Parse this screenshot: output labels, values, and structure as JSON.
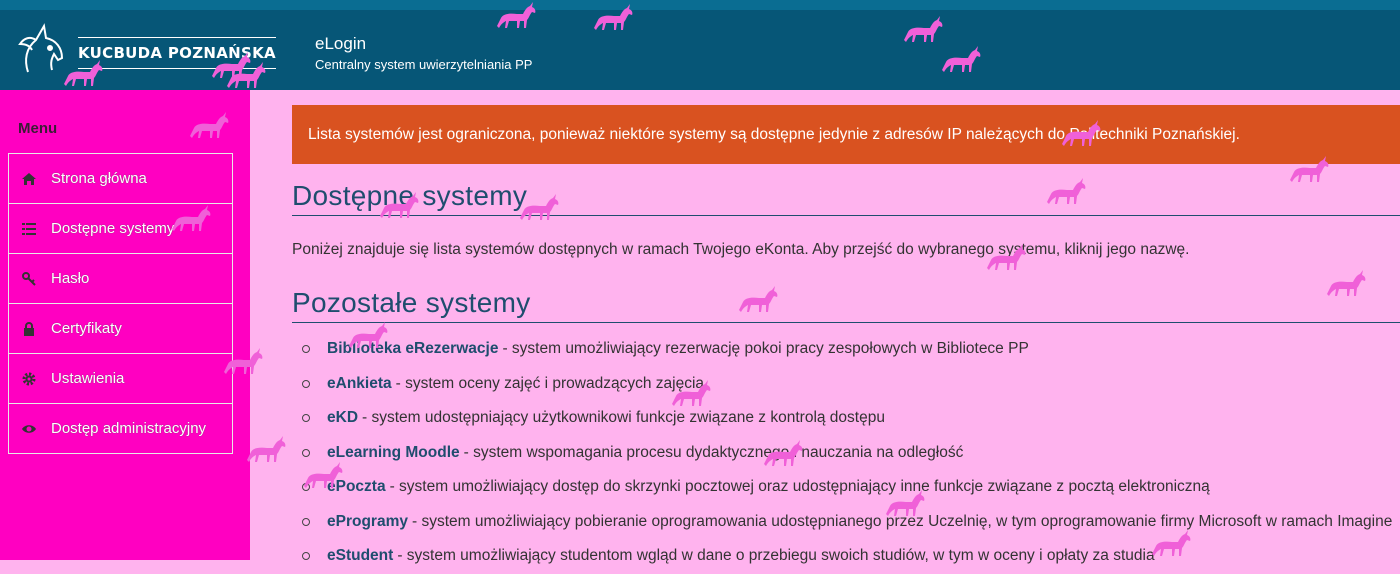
{
  "header": {
    "logo_text": "KUCBUDA POZNAŃSKA",
    "app_title": "eLogin",
    "app_subtitle": "Centralny system uwierzytelniania PP"
  },
  "sidebar": {
    "heading": "Menu",
    "items": [
      {
        "label": "Strona główna",
        "icon": "home-icon"
      },
      {
        "label": "Dostępne systemy",
        "icon": "list-icon"
      },
      {
        "label": "Hasło",
        "icon": "key-icon"
      },
      {
        "label": "Certyfikaty",
        "icon": "lock-icon"
      },
      {
        "label": "Ustawienia",
        "icon": "gear-icon"
      },
      {
        "label": "Dostęp administracyjny",
        "icon": "eye-icon"
      }
    ]
  },
  "main": {
    "alert": "Lista systemów jest ograniczona, ponieważ niektóre systemy są dostępne jedynie z adresów IP należących do Politechniki Poznańskiej.",
    "available_heading": "Dostępne systemy",
    "intro": "Poniżej znajduje się lista systemów dostępnych w ramach Twojego eKonta. Aby przejść do wybranego systemu, kliknij jego nazwę.",
    "other_heading": "Pozostałe systemy",
    "systems": [
      {
        "name": "Biblioteka eRezerwacje",
        "desc": "- system umożliwiający rezerwację pokoi pracy zespołowych w Bibliotece PP"
      },
      {
        "name": "eAnkieta",
        "desc": "- system oceny zajęć i prowadzących zajęcia"
      },
      {
        "name": "eKD",
        "desc": "- system udostępniający użytkownikowi funkcje związane z kontrolą dostępu"
      },
      {
        "name": "eLearning Moodle",
        "desc": "- system wspomagania procesu dydaktycznego i nauczania na odległość"
      },
      {
        "name": "ePoczta",
        "desc": "- system umożliwiający dostęp do skrzynki pocztowej oraz udostępniający inne funkcje związane z pocztą elektroniczną"
      },
      {
        "name": "eProgramy",
        "desc": "- system umożliwiający pobieranie oprogramowania udostępnianego przez Uczelnię, w tym oprogramowanie firmy Microsoft w ramach Imagine"
      },
      {
        "name": "eStudent",
        "desc": "- system umożliwiający studentom wgląd w dane o przebiegu swoich studiów, w tym w oceny i opłaty za studia"
      }
    ]
  },
  "colors": {
    "header_bg": "#065677",
    "sidebar_bg": "#ff00c1",
    "page_bg": "#ffb3ee",
    "alert_bg": "#d95220",
    "link": "#1f4d6e",
    "unicorn": "#f060d8"
  }
}
